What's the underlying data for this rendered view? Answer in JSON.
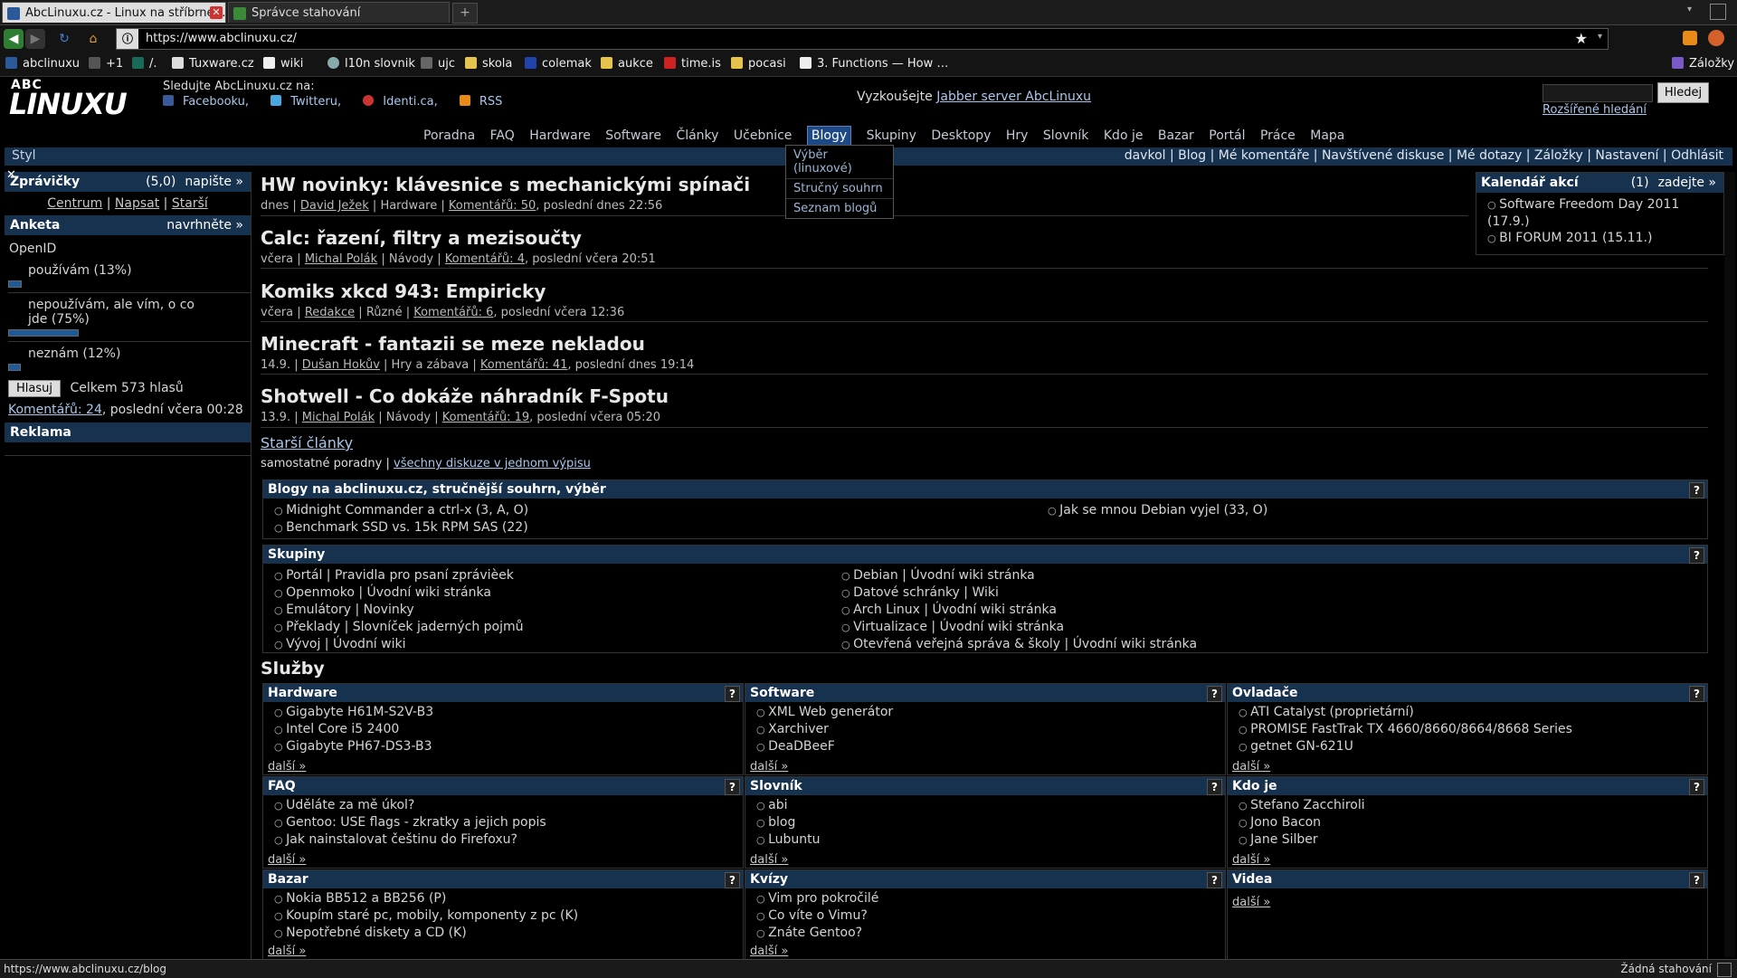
{
  "browser": {
    "tabs": [
      {
        "title": "AbcLinuxu.cz - Linux na stříbrné…",
        "active": true
      },
      {
        "title": "Správce stahování",
        "active": false
      }
    ],
    "url": "https://www.abclinuxu.cz/",
    "bookmarks": [
      "abclinuxu",
      "+1",
      "/.",
      "Tuxware.cz",
      "wiki",
      "l10n slovnik",
      "ujc",
      "skola",
      "colemak",
      "aukce",
      "time.is",
      "pocasi",
      "3. Functions — How …",
      "Záložky"
    ],
    "status_url": "https://www.abclinuxu.cz/blog",
    "downloads_status": "Žádná stahování"
  },
  "header": {
    "logo_top": "ABC",
    "logo_main": "LINUXU",
    "follow_text": "Sledujte AbcLinuxu.cz na:",
    "follow_links": [
      "Facebooku,",
      "Twitteru,",
      "Identi.ca,",
      "RSS"
    ],
    "jabber_prefix": "Vyzkoušejte",
    "jabber_link": "Jabber server AbcLinuxu",
    "search_button": "Hledej",
    "advanced_search": "Rozšířené hledání"
  },
  "menu": {
    "items": [
      "Poradna",
      "FAQ",
      "Hardware",
      "Software",
      "Články",
      "Učebnice",
      "Blogy",
      "Skupiny",
      "Desktopy",
      "Hry",
      "Slovník",
      "Kdo je",
      "Bazar",
      "Portál",
      "Práce",
      "Mapa"
    ],
    "selected": "Blogy",
    "dropdown": [
      "Výběr (linuxové)",
      "Stručný souhrn",
      "Seznam blogů"
    ],
    "styl": "Styl",
    "user_links": [
      "davkol",
      "Blog",
      "Mé komentáře",
      "Navštívené diskuse",
      "Mé dotazy",
      "Záložky",
      "Nastavení",
      "Odhlásit"
    ]
  },
  "left": {
    "zpravicky": {
      "title": "Zprávičky",
      "count": "(5,0)",
      "action": "napište »",
      "links": [
        "Centrum",
        "Napsat",
        "Starší"
      ]
    },
    "anketa": {
      "title": "Anketa",
      "action": "navrhněte »",
      "question": "OpenID",
      "options": [
        {
          "label": "používám (13%)",
          "percent": 13
        },
        {
          "label": "nepoužívám, ale vím, o co jde (75%)",
          "percent": 75
        },
        {
          "label": "neznám (12%)",
          "percent": 12
        }
      ],
      "vote_button": "Hlasuj",
      "total": "Celkem 573 hlasů",
      "comments_link": "Komentářů: 24",
      "comments_tail": ", poslední včera 00:28"
    },
    "reklama": "Reklama"
  },
  "articles": [
    {
      "title": "HW novinky: klávesnice s mechanickými spínači",
      "when": "dnes",
      "author": "David Ježek",
      "section": "Hardware",
      "comments": "Komentářů: 50",
      "last": ", poslední dnes 22:56"
    },
    {
      "title": "Calc: řazení, filtry a mezisoučty",
      "when": "včera",
      "author": "Michal Polák",
      "section": "Návody",
      "comments": "Komentářů: 4",
      "last": ", poslední včera 20:51"
    },
    {
      "title": "Komiks xkcd 943: Empiricky",
      "when": "včera",
      "author": "Redakce",
      "section": "Různé",
      "comments": "Komentářů: 6",
      "last": ", poslední včera 12:36"
    },
    {
      "title": "Minecraft - fantazii se meze nekladou",
      "when": "14.9.",
      "author": "Dušan Hokův",
      "section": "Hry a zábava",
      "comments": "Komentářů: 41",
      "last": ", poslední dnes 19:14"
    },
    {
      "title": "Shotwell - Co dokáže náhradník F-Spotu",
      "when": "13.9.",
      "author": "Michal Polák",
      "section": "Návody",
      "comments": "Komentářů: 19",
      "last": ", poslední včera 05:20"
    }
  ],
  "older": {
    "link": "Starší články",
    "text": "samostatné poradny |",
    "all_link": "všechny diskuze v jednom výpisu"
  },
  "blogs": {
    "title": "Blogy na abclinuxu.cz, stručnější souhrn, výběr",
    "left": [
      "Midnight Commander a ctrl-x (3, A, O)",
      "Benchmark SSD vs. 15k RPM SAS (22)"
    ],
    "right": [
      "Jak se mnou Debian vyjel (33, O)"
    ]
  },
  "groups": {
    "title": "Skupiny",
    "left": [
      "Portál | Pravidla pro psaní zprávièek",
      "Openmoko | Úvodní wiki stránka",
      "Emulátory | Novinky",
      "Překlady | Slovníček jaderných pojmů",
      "Vývoj | Úvodní wiki"
    ],
    "right": [
      "Debian | Úvodní wiki stránka",
      "Datové schránky | Wiki",
      "Arch Linux | Úvodní wiki stránka",
      "Virtualizace | Úvodní wiki stránka",
      "Otevřená veřejná správa & školy | Úvodní wiki stránka"
    ]
  },
  "services": {
    "title": "Služby",
    "more": "další »",
    "boxes": [
      {
        "title": "Hardware",
        "items": [
          "Gigabyte H61M-S2V-B3",
          "Intel Core i5 2400",
          "Gigabyte PH67-DS3-B3"
        ]
      },
      {
        "title": "Software",
        "items": [
          "XML Web generátor",
          "Xarchiver",
          "DeaDBeeF"
        ]
      },
      {
        "title": "Ovladače",
        "items": [
          "ATI Catalyst (proprietární)",
          "PROMISE FastTrak TX 4660/8660/8664/8668 Series",
          "getnet GN-621U"
        ]
      },
      {
        "title": "FAQ",
        "items": [
          "Uděláte za mě úkol?",
          "Gentoo: USE flags - zkratky a jejich popis",
          "Jak nainstalovat češtinu do Firefoxu?"
        ]
      },
      {
        "title": "Slovník",
        "items": [
          "abi",
          "blog",
          "Lubuntu"
        ]
      },
      {
        "title": "Kdo je",
        "items": [
          "Stefano Zacchiroli",
          "Jono Bacon",
          "Jane Silber"
        ]
      },
      {
        "title": "Bazar",
        "items": [
          "Nokia BB512 a BB256 (P)",
          "Koupím staré pc, mobily, komponenty z pc (K)",
          "Nepotřebné diskety a CD (K)"
        ]
      },
      {
        "title": "Kvízy",
        "items": [
          "Vim pro pokročilé",
          "Co víte o Vimu?",
          "Znáte Gentoo?"
        ]
      },
      {
        "title": "Videa",
        "items": []
      }
    ]
  },
  "calendar": {
    "title": "Kalendář akcí",
    "count": "(1)",
    "action": "zadejte »",
    "events": [
      "Software Freedom Day 2011 (17.9.)",
      "BI FORUM 2011 (15.11.)"
    ]
  }
}
